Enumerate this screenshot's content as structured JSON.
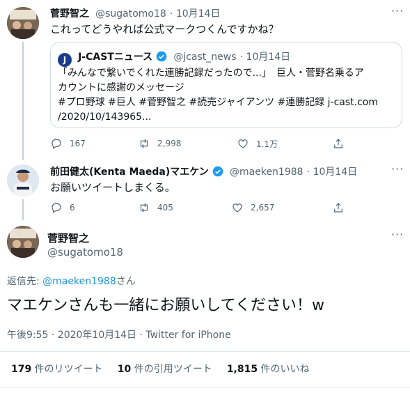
{
  "tweet1": {
    "name": "菅野智之",
    "handle": "@sugatomo18",
    "date": "10月14日",
    "text": "これってどうやれば公式マークつくんですかね？",
    "quote": {
      "name": "J-CASTニュース",
      "handle": "@jcast_news",
      "date": "10月14日",
      "line1": "「みんなで繋いでくれた連勝記録だったので...」　巨人・菅野名乗るア",
      "line2": "カウントに感謝のメッセージ",
      "line3": "#プロ野球 #巨人 #菅野智之 #読売ジャイアンツ #連勝記録 j-cast.com",
      "line4": "/2020/10/143965..."
    },
    "replies": "167",
    "retweets": "2,998",
    "likes": "1.1万"
  },
  "tweet2": {
    "name": "前田健太(Kenta Maeda)マエケン",
    "handle": "@maeken1988",
    "date": "10月14日",
    "text": "お願いツイートしまくる。",
    "replies": "6",
    "retweets": "405",
    "likes": "2,657"
  },
  "main": {
    "name": "菅野智之",
    "handle": "@sugatomo18",
    "reply_prefix": "返信先: ",
    "reply_to": "@maeken1988",
    "reply_suffix": "さん",
    "text": "マエケンさんも一緒にお願いしてください！w",
    "time": "午後9:55 · 2020年10月14日 · ",
    "client": "Twitter for iPhone",
    "stats": {
      "retweets_num": "179",
      "retweets_label": " 件のリツイート",
      "quotes_num": "10",
      "quotes_label": " 件の引用ツイート",
      "likes_num": "1,815",
      "likes_label": " 件のいいね"
    }
  },
  "colors": {
    "link": "#1b95e0",
    "verified": "#1d9bf0",
    "muted": "#536471"
  }
}
